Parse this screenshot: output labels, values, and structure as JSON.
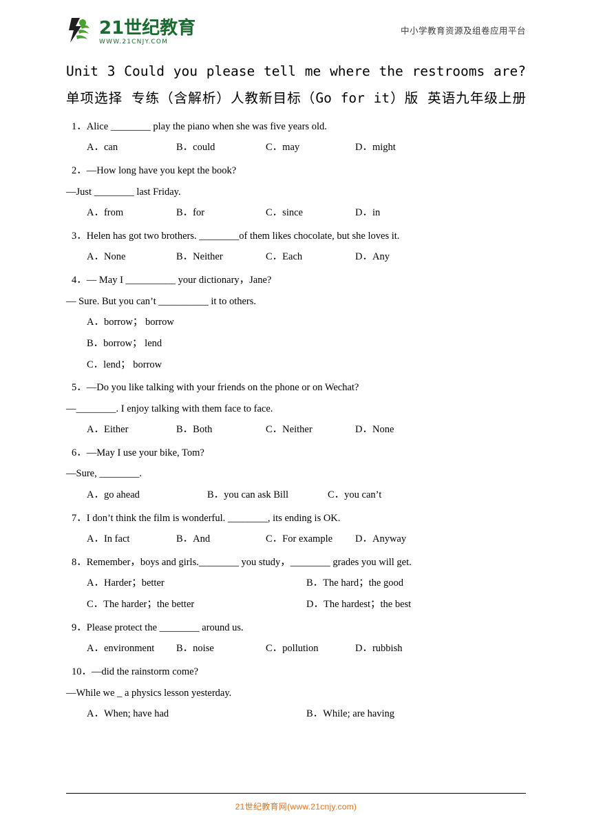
{
  "header": {
    "logo_main": "21世纪教育",
    "logo_sub": "WWW.21CNJY.COM",
    "slogan": "中小学教育资源及组卷应用平台"
  },
  "title": "Unit 3 Could you please tell me where the restrooms are? 单项选择 专练（含解析）人教新目标（Go for it）版 英语九年级上册",
  "questions": [
    {
      "num": "1．",
      "stem": "Alice ________ play the piano when she was five years old.",
      "lines": [],
      "layout": "row-130",
      "options": [
        "A．can",
        "B．could",
        "C．may",
        "D．might"
      ]
    },
    {
      "num": "2．",
      "stem": "—How long have you kept the book?",
      "lines": [
        "—Just ________ last Friday."
      ],
      "layout": "row-130",
      "options": [
        "A．from",
        "B．for",
        "C．since",
        "D．in"
      ]
    },
    {
      "num": "3．",
      "stem": "Helen has got two brothers. ________of them likes chocolate, but she loves it.",
      "lines": [],
      "layout": "row-130",
      "options": [
        "A．None",
        "B．Neither",
        "C．Each",
        "D．Any"
      ]
    },
    {
      "num": "4．",
      "stem": "— May I __________ your dictionary，Jane?",
      "lines": [
        "— Sure. But you can’t __________ it to others."
      ],
      "layout": "stack",
      "options": [
        "A．borrow； borrow",
        "B．borrow； lend",
        "C．lend； borrow"
      ]
    },
    {
      "num": "5．",
      "stem": "—Do you like talking with your friends on the phone or on Wechat?",
      "lines": [
        "—________. I enjoy talking with them face to face."
      ],
      "layout": "row-130",
      "options": [
        "A．Either",
        "B．Both",
        "C．Neither",
        "D．None"
      ]
    },
    {
      "num": "6．",
      "stem": "—May I use your bike, Tom?",
      "lines": [
        "—Sure, ________."
      ],
      "layout": "row-175",
      "options": [
        "A．go ahead",
        "B．you can ask Bill",
        "C．you can’t"
      ]
    },
    {
      "num": "7．",
      "stem": "I don’t think the film is wonderful. ________, its ending is OK.",
      "lines": [],
      "layout": "row-130",
      "options": [
        "A．In fact",
        "B．And",
        "C．For example",
        "D．Anyway"
      ]
    },
    {
      "num": "8．",
      "stem": "Remember，boys and girls.________ you study，________ grades you will get.",
      "lines": [],
      "layout": "two-col",
      "options": [
        "A．Harder；better",
        "B．The hard；the good",
        "C．The harder；the better",
        "D．The hardest；the best"
      ]
    },
    {
      "num": "9．",
      "stem": "Please protect the ________ around us.",
      "lines": [],
      "layout": "row-130",
      "options": [
        "A．environment",
        "B．noise",
        "C．pollution",
        "D．rubbish"
      ]
    },
    {
      "num": "10．",
      "stem": "—did the rainstorm come?",
      "lines": [
        "—While we _ a physics lesson yesterday."
      ],
      "layout": "two-col-10",
      "options": [
        "A．When; have had",
        "B．While; are having"
      ]
    }
  ],
  "footer": {
    "text": "21世纪教育网(www.21cnjy.com)"
  }
}
